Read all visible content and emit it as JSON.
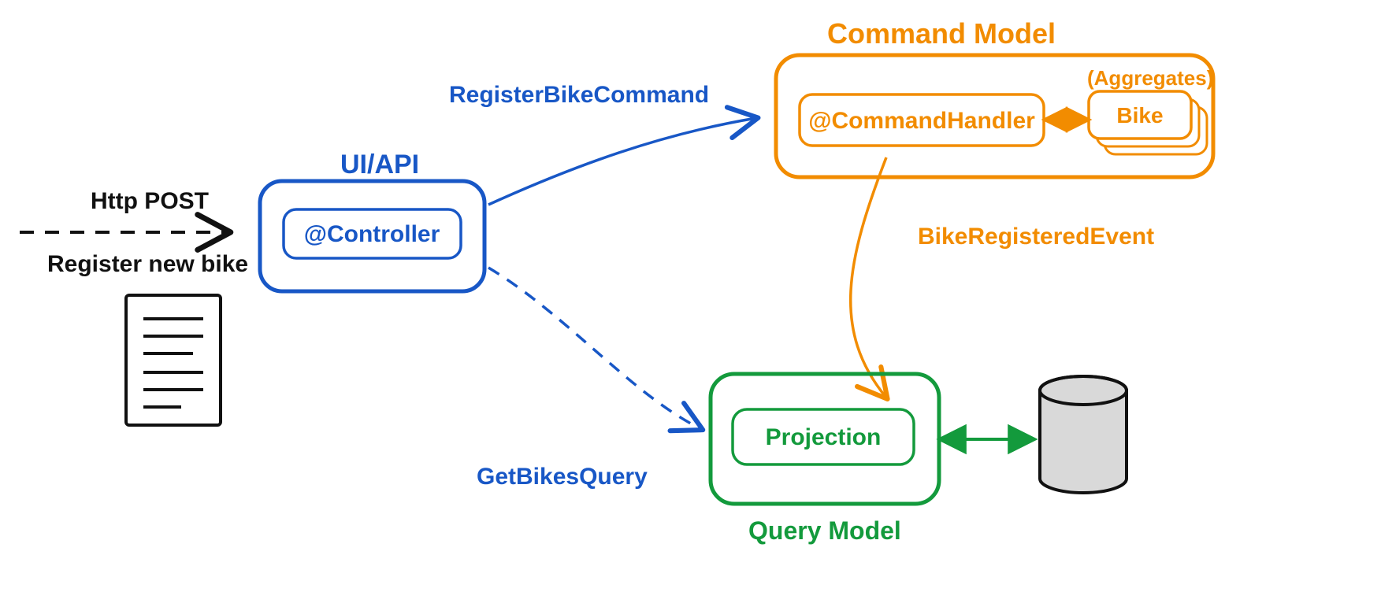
{
  "colors": {
    "blue": "#1857c6",
    "orange": "#f28c00",
    "green": "#139a3c",
    "black": "#111111",
    "dbfill": "#d9d9d9"
  },
  "labels": {
    "http_post": "Http POST",
    "register_new_bike": "Register new bike",
    "ui_api": "UI/API",
    "controller": "@Controller",
    "command_model": "Command Model",
    "command_handler": "@CommandHandler",
    "aggregates": "(Aggregates)",
    "bike": "Bike",
    "register_bike_cmd": "RegisterBikeCommand",
    "bike_reg_event": "BikeRegisteredEvent",
    "query_model": "Query Model",
    "projection": "Projection",
    "get_bikes_query": "GetBikesQuery"
  }
}
